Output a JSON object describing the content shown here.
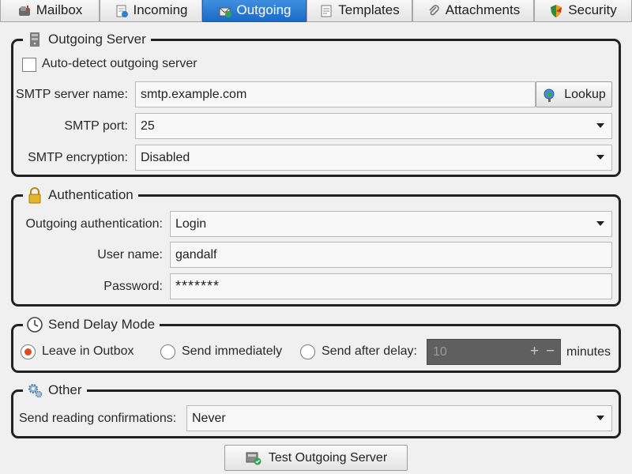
{
  "tabs": [
    {
      "label": "Mailbox",
      "icon": "mailbox-icon",
      "active": false
    },
    {
      "label": "Incoming",
      "icon": "incoming-icon",
      "active": false
    },
    {
      "label": "Outgoing",
      "icon": "outgoing-icon",
      "active": true
    },
    {
      "label": "Templates",
      "icon": "templates-icon",
      "active": false
    },
    {
      "label": "Attachments",
      "icon": "paperclip-icon",
      "active": false
    },
    {
      "label": "Security",
      "icon": "shield-icon",
      "active": false
    }
  ],
  "outgoing_server": {
    "title": "Outgoing Server",
    "auto_detect_label": "Auto-detect outgoing server",
    "auto_detect_checked": false,
    "smtp_server_label": "SMTP server name:",
    "smtp_server_value": "smtp.example.com",
    "lookup_label": "Lookup",
    "smtp_port_label": "SMTP port:",
    "smtp_port_value": "25",
    "smtp_encryption_label": "SMTP encryption:",
    "smtp_encryption_value": "Disabled"
  },
  "authentication": {
    "title": "Authentication",
    "method_label": "Outgoing authentication:",
    "method_value": "Login",
    "username_label": "User name:",
    "username_value": "gandalf",
    "password_label": "Password:",
    "password_value": "*******"
  },
  "send_delay": {
    "title": "Send Delay Mode",
    "options": [
      {
        "label": "Leave in Outbox",
        "checked": true
      },
      {
        "label": "Send immediately",
        "checked": false
      },
      {
        "label": "Send after delay:",
        "checked": false
      }
    ],
    "delay_value": "10",
    "plus": "+",
    "minus": "−",
    "unit": "minutes"
  },
  "other": {
    "title": "Other",
    "confirm_label": "Send reading confirmations:",
    "confirm_value": "Never"
  },
  "test_button_label": "Test Outgoing Server",
  "colors": {
    "accent_tab": "#1a6ac8",
    "radio_selected": "#e04a1e",
    "group_border": "#222222"
  }
}
